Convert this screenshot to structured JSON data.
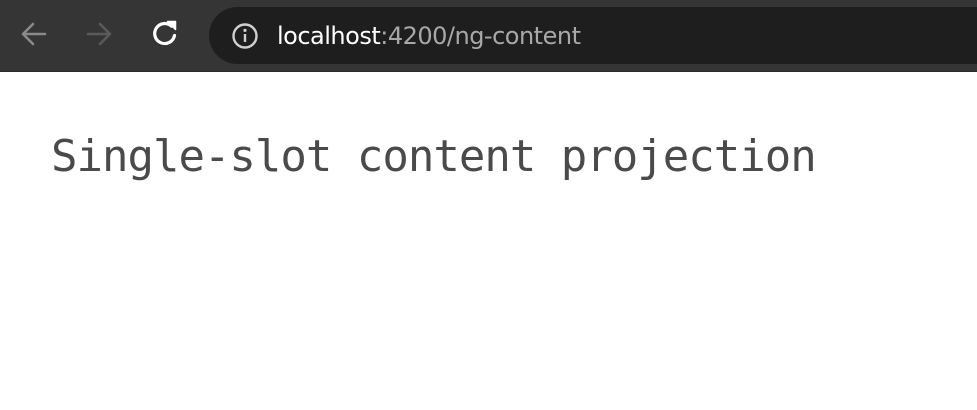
{
  "browser": {
    "url_host": "localhost",
    "url_rest": ":4200/ng-content",
    "icons": {
      "back": "arrow-left-icon",
      "forward": "arrow-right-icon",
      "reload": "reload-icon",
      "site_info": "info-circle-icon"
    },
    "colors": {
      "toolbar": "#353535",
      "address_bar": "#1e1e1e",
      "url_host": "#ffffff",
      "url_rest": "#a8a8a8"
    }
  },
  "page": {
    "heading": "Single-slot content projection",
    "colors": {
      "background": "#ffffff",
      "heading": "#4a4a4a"
    }
  }
}
